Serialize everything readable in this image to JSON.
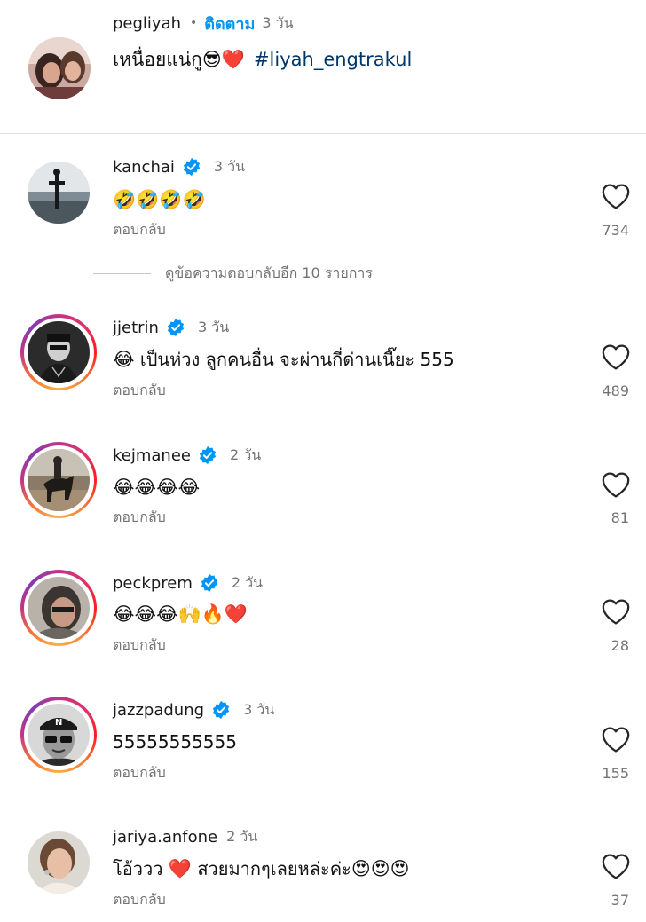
{
  "caption": {
    "username": "pegliyah",
    "follow_label": "ติดตาม",
    "time": "3 วัน",
    "text": "เหนื่อยแน่กู",
    "emojis": "😎❤️",
    "hashtag": "#liyah_engtrakul"
  },
  "reply_label": "ตอบกลับ",
  "comments": [
    {
      "username": "kanchai",
      "verified": true,
      "time": "3 วัน",
      "text": "🤣🤣🤣🤣",
      "likes": "734",
      "view_replies": "ดูข้อความตอบกลับอีก 10 รายการ"
    },
    {
      "username": "jjetrin",
      "verified": true,
      "time": "3 วัน",
      "emoji": "😂",
      "text": " เป็นห่วง ลูกคนอื่น จะผ่านกี่ด่านเนี๊ยะ 555",
      "likes": "489"
    },
    {
      "username": "kejmanee",
      "verified": true,
      "time": "2 วัน",
      "text": "😂😂😂😂",
      "likes": "81"
    },
    {
      "username": "peckprem",
      "verified": true,
      "time": "2 วัน",
      "text": "😂😂😂🙌🔥❤️",
      "likes": "28"
    },
    {
      "username": "jazzpadung",
      "verified": true,
      "time": "3 วัน",
      "text": "55555555555",
      "likes": "155"
    },
    {
      "username": "jariya.anfone",
      "verified": false,
      "time": "2 วัน",
      "text_part1": "โอ้ววว ",
      "heart": "❤️",
      "text_part2": " สวยมากๆเลยหล่ะค่ะ",
      "emojis": "😍😍😍",
      "likes": "37"
    }
  ],
  "colors": {
    "follow_blue": "#0095f6",
    "hashtag_blue": "#00376b",
    "verified_blue": "#0095f6",
    "secondary_text": "#737373"
  }
}
